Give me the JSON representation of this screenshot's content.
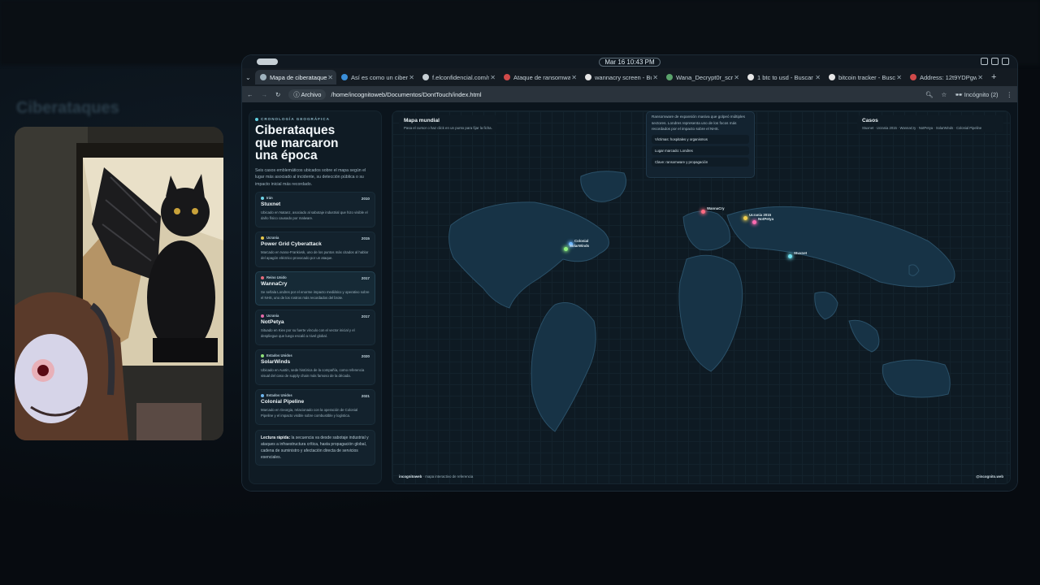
{
  "background": {
    "blurred_title": "Ciberataques"
  },
  "system": {
    "clock": "Mar 16  10:43 PM"
  },
  "tabs": [
    {
      "label": "Mapa de ciberataques",
      "color": "#9fb3bf",
      "active": true
    },
    {
      "label": "Así es como un cibera",
      "color": "#3a8fd9",
      "active": false
    },
    {
      "label": "f.elconfidencial.com/n",
      "color": "#c7cfd4",
      "active": false
    },
    {
      "label": "Ataque de ransomware",
      "color": "#d04a4a",
      "active": false
    },
    {
      "label": "wannacry screen - Bus",
      "color": "#e6e6e6",
      "active": false
    },
    {
      "label": "Wana_Decrypt0r_scre",
      "color": "#5aa36b",
      "active": false
    },
    {
      "label": "1 btc to usd - Buscar c",
      "color": "#e6e6e6",
      "active": false
    },
    {
      "label": "bitcoin tracker - Busc",
      "color": "#e6e6e6",
      "active": false
    },
    {
      "label": "Address: 12t9YDPgw",
      "color": "#d04a4a",
      "active": false
    }
  ],
  "urlbar": {
    "archivo": "Archivo",
    "path": "/home/incognitoweb/Documentos/DontTouch/index.html",
    "incognito": "Incógnito (2)"
  },
  "left": {
    "eyebrow": "CRONOLOGÍA GEOGRÁFICA",
    "title": "Ciberataques que marcaron una época",
    "intro": "Seis casos emblemáticos ubicados sobre el mapa según el lugar más asociado al incidente, su detección pública o su impacto inicial más recordado.",
    "cards": [
      {
        "loc": "Irán",
        "year": "2010",
        "name": "Stuxnet",
        "desc": "Ubicado en Natanz, asociado al sabotaje industrial que hizo visible el daño físico causado por malware.",
        "color": "#6fd3e6",
        "selected": false
      },
      {
        "loc": "Ucrania",
        "year": "2015",
        "name": "Power Grid Cyberattack",
        "desc": "Marcado en Ivano-Frankivsk, uno de los puntos más citados al hablar del apagón eléctrico provocado por un ataque.",
        "color": "#e6c84a",
        "selected": false
      },
      {
        "loc": "Reino Unido",
        "year": "2017",
        "name": "WannaCry",
        "desc": "Se señala Londres por el enorme impacto mediático y operativo sobre el NHS, uno de los rostros más recordados del brote.",
        "color": "#e56a7a",
        "selected": true
      },
      {
        "loc": "Ucrania",
        "year": "2017",
        "name": "NotPetya",
        "desc": "Situado en Kiev por su fuerte vínculo con el vector inicial y el despliegue que luego escaló a nivel global.",
        "color": "#e56aa8",
        "selected": false
      },
      {
        "loc": "Estados Unidos",
        "year": "2020",
        "name": "SolarWinds",
        "desc": "Ubicado en Austin, sede histórica de la compañía, como referencia visual del caso de supply chain más famoso de la década.",
        "color": "#8fe07a",
        "selected": false
      },
      {
        "loc": "Estados Unidos",
        "year": "2021",
        "name": "Colonial Pipeline",
        "desc": "Marcado en Georgia, relacionado con la operación de Colonial Pipeline y el impacto visible sobre combustible y logística.",
        "color": "#6fb5ee",
        "selected": false
      }
    ],
    "quick_label": "Lectura rápida:",
    "quick_text": "la secuencia va desde sabotaje industrial y ataques a infraestructura crítica, hasta propagación global, cadena de suministro y afectación directa de servicios esenciales."
  },
  "map": {
    "title": "Mapa mundial",
    "subtitle": "Pasa el cursor o haz click en un punto para fijar la ficha.",
    "cases_title": "Casos",
    "cases_list": "Stuxnet · Ucrania 2015 · WannaCry · NotPetya · SolarWinds · Colonial Pipeline",
    "popup_desc": "Ransomware de expansión masiva que golpeó múltiples sectores. Londres representa uno de los focos más recordados por el impacto sobre el NHS.",
    "popup_rows": [
      "Víctimas: hospitales y organismos",
      "Lugar marcado: Londres",
      "Clave: ransomware y propagación"
    ],
    "pins": [
      {
        "label": "WannaCry",
        "color": "#ff6b82"
      },
      {
        "label": "Ucrania 2015",
        "color": "#f0d050"
      },
      {
        "label": "NotPetya",
        "color": "#ff6bb0"
      },
      {
        "label": "Stuxnet",
        "color": "#70e0f0"
      },
      {
        "label": "Colonial",
        "color": "#70b8ff"
      },
      {
        "label": "SolarWinds",
        "color": "#90f080"
      }
    ],
    "footer_brand": "incognitoweb",
    "footer_text": "· mapa interactivo de referencia",
    "footer_handle": "@incognito.web"
  }
}
